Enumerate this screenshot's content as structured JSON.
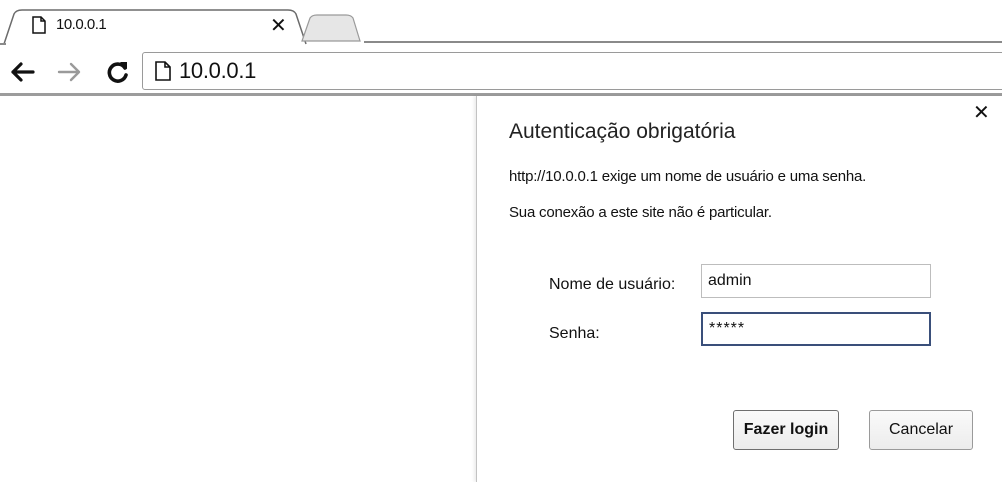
{
  "browser": {
    "tab": {
      "title": "10.0.0.1",
      "page_icon": "page-icon",
      "close_icon": "close-icon"
    },
    "new_tab_icon": "new-tab-icon",
    "toolbar": {
      "back_icon": "back-arrow-icon",
      "forward_icon": "forward-arrow-icon",
      "reload_icon": "reload-icon",
      "address": "10.0.0.1"
    }
  },
  "dialog": {
    "title": "Autenticação obrigatória",
    "message_line1": "http://10.0.0.1 exige um nome de usuário e uma senha.",
    "message_line2": "Sua conexão a este site não é particular.",
    "username_label": "Nome de usuário:",
    "username_value": "admin",
    "password_label": "Senha:",
    "password_value": "*****",
    "login_button": "Fazer login",
    "cancel_button": "Cancelar",
    "close_icon": "close-icon"
  }
}
